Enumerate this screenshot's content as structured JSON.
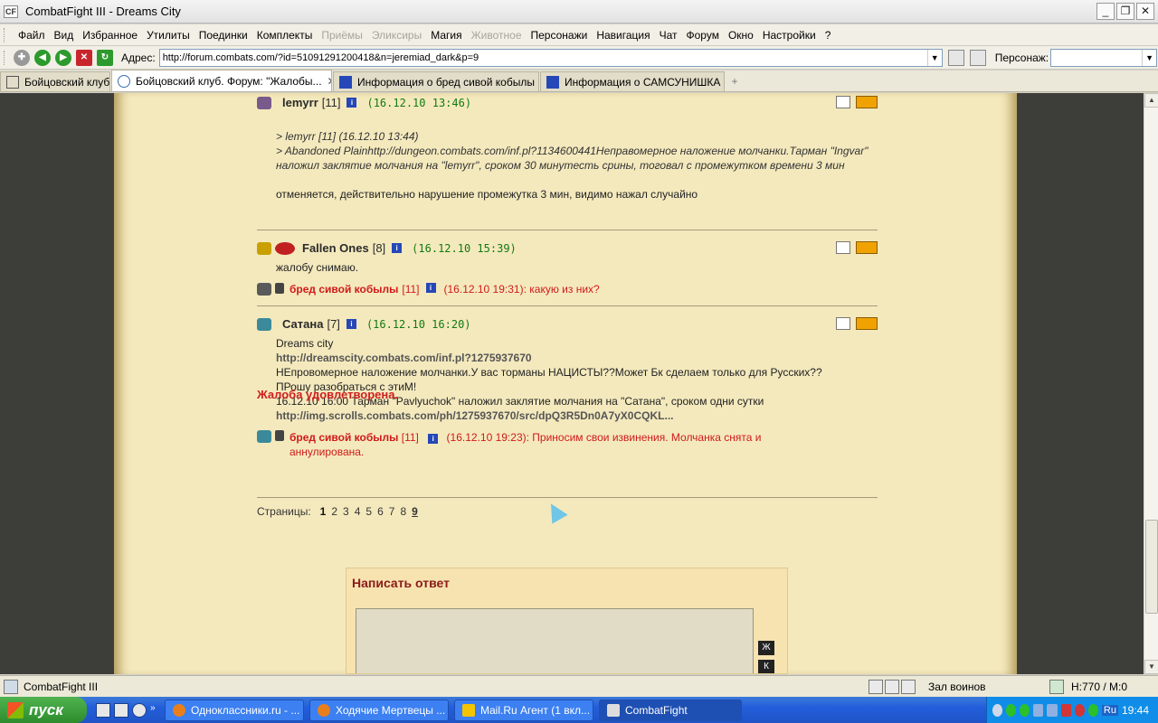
{
  "window": {
    "title": "CombatFight III - Dreams City"
  },
  "menu": [
    "Файл",
    "Вид",
    "Избранное",
    "Утилиты",
    "Поединки",
    "Комплекты",
    "Приёмы",
    "Эликсиры",
    "Магия",
    "Животное",
    "Персонажи",
    "Навигация",
    "Чат",
    "Форум",
    "Окно",
    "Настройки",
    "?"
  ],
  "menu_disabled": [
    "Приёмы",
    "Эликсиры",
    "Животное"
  ],
  "address": {
    "label": "Адрес:",
    "url": "http://forum.combats.com/?id=51091291200418&n=jeremiad_dark&p=9"
  },
  "persona": {
    "label": "Персонаж:",
    "value": ""
  },
  "tabs": [
    {
      "label": "Бойцовский клуб",
      "active": false
    },
    {
      "label": "Бойцовский клуб. Форум: \"Жалобы...",
      "active": true
    },
    {
      "label": "Информация о бред сивой кобылы",
      "active": false
    },
    {
      "label": "Информация о САМСУНИШКА",
      "active": false
    }
  ],
  "posts": [
    {
      "nick": "lemyrr",
      "level": "[11]",
      "date": "(16.12.10 13:46)",
      "quote": [
        ">   lemyrr [11] (16.12.10 13:44)",
        "> Abandoned Plainhttp://dungeon.combats.com/inf.pl?1134600441Неправомерное наложение молчанки.Тарман \"Ingvar\" наложил заклятие молчания на \"lemyrr\", сроком 30 минутесть срины, тоговал с промежутком времени 3 мин"
      ],
      "text": "отменяется, действительно нарушение промежутка 3 мин, видимо нажал случайно"
    },
    {
      "nick": "Fallen Ones",
      "level": "[8]",
      "date": "(16.12.10 15:39)",
      "text": "жалобу снимаю.",
      "reply": {
        "nick": "бред сивой кобылы",
        "level": "[11]",
        "text": "(16.12.10 19:31): какую из них?"
      }
    },
    {
      "nick": "Сатана",
      "level": "[7]",
      "date": "(16.12.10 16:20)",
      "lines": [
        "Dreams city",
        "http://dreamscity.combats.com/inf.pl?1275937670",
        "НЕпровомерное наложение молчанки.У вас торманы НАЦИСТЫ??Может Бк сделаем только для Русских??",
        "ПРошу разобраться с этиМ!",
        "16.12.10 16:00 Тарман \"Pavlyuchok\" наложил заклятие молчания на \"Сатана\", сроком одни сутки",
        "http://img.scrolls.combats.com/ph/1275937670/src/dpQ3R5Dn0A7yX0CQKL..."
      ],
      "reply": {
        "nick": "бред сивой кобылы",
        "level": "[11]",
        "text": "(16.12.10 19:23): Приносим свои извинения. Молчанка снята и аннулирована."
      }
    }
  ],
  "resolved": "Жалоба удовлетворена.",
  "pages": {
    "label": "Страницы:",
    "items": [
      "1",
      "2",
      "3",
      "4",
      "5",
      "6",
      "7",
      "8",
      "9"
    ]
  },
  "reply_box": {
    "title": "Написать ответ",
    "fmt": [
      "Ж",
      "К"
    ]
  },
  "status": {
    "left": "CombatFight III",
    "zone": "Зал воинов",
    "hm": "H:770 / M:0"
  },
  "taskbar": {
    "start": "пуск",
    "buttons": [
      {
        "label": "Одноклассники.ru - ...",
        "active": false
      },
      {
        "label": "Ходячие Мертвецы ...",
        "active": false
      },
      {
        "label": "Mail.Ru Агент (1 вкл...",
        "active": false
      },
      {
        "label": "CombatFight",
        "active": true
      }
    ],
    "lang": "Ru",
    "clock": "19:44"
  },
  "colors": {
    "accent_red": "#d01b1b",
    "date_green": "#117a11",
    "parchment": "#f4e9bd"
  }
}
